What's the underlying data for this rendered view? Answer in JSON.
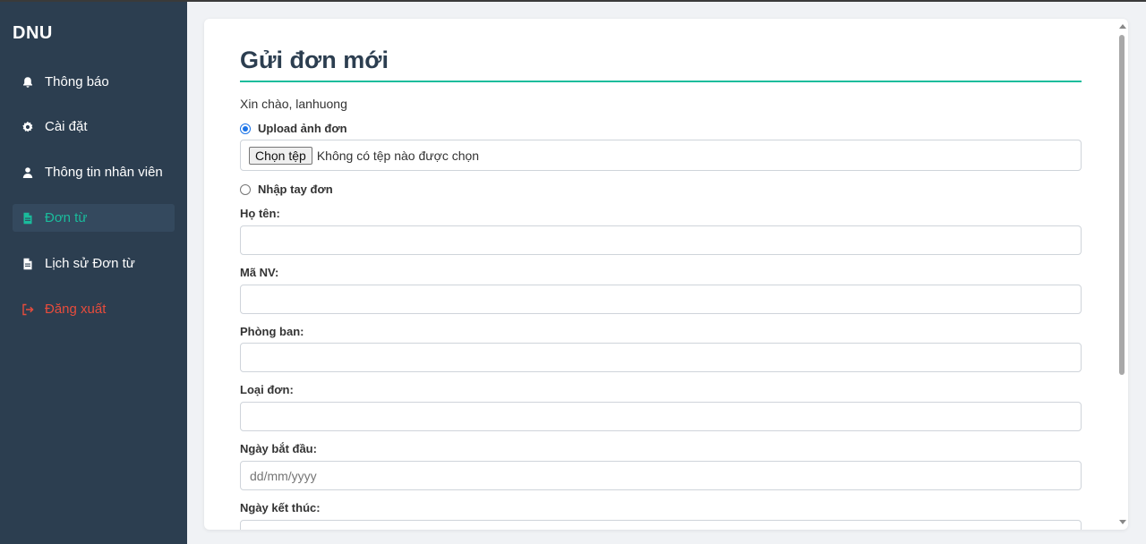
{
  "sidebar": {
    "brand": "DNU",
    "items": [
      {
        "label": "Thông báo",
        "icon": "bell-icon"
      },
      {
        "label": "Cài đặt",
        "icon": "gear-icon"
      },
      {
        "label": "Thông tin nhân viên",
        "icon": "user-icon"
      },
      {
        "label": "Đơn từ",
        "icon": "document-icon",
        "active": true
      },
      {
        "label": "Lịch sử Đơn từ",
        "icon": "document-icon"
      },
      {
        "label": "Đăng xuất",
        "icon": "logout-icon"
      }
    ]
  },
  "colors": {
    "sidebar_bg": "#2c3e50",
    "accent": "#1abc9c",
    "logout": "#e74c3c"
  },
  "form": {
    "title": "Gửi đơn mới",
    "greeting": "Xin chào, lanhuong",
    "upload_option": "Upload ảnh đơn",
    "upload_selected": true,
    "file_button": "Chọn tệp",
    "file_status": "Không có tệp nào được chọn",
    "manual_option": "Nhập tay đơn",
    "fields": {
      "full_name": {
        "label": "Họ tên:",
        "value": ""
      },
      "employee_id": {
        "label": "Mã NV:",
        "value": ""
      },
      "department": {
        "label": "Phòng ban:",
        "value": ""
      },
      "request_type": {
        "label": "Loại đơn:",
        "value": ""
      },
      "start_date": {
        "label": "Ngày bắt đầu:",
        "placeholder": "dd/mm/yyyy"
      },
      "end_date": {
        "label": "Ngày kết thúc:"
      }
    }
  }
}
